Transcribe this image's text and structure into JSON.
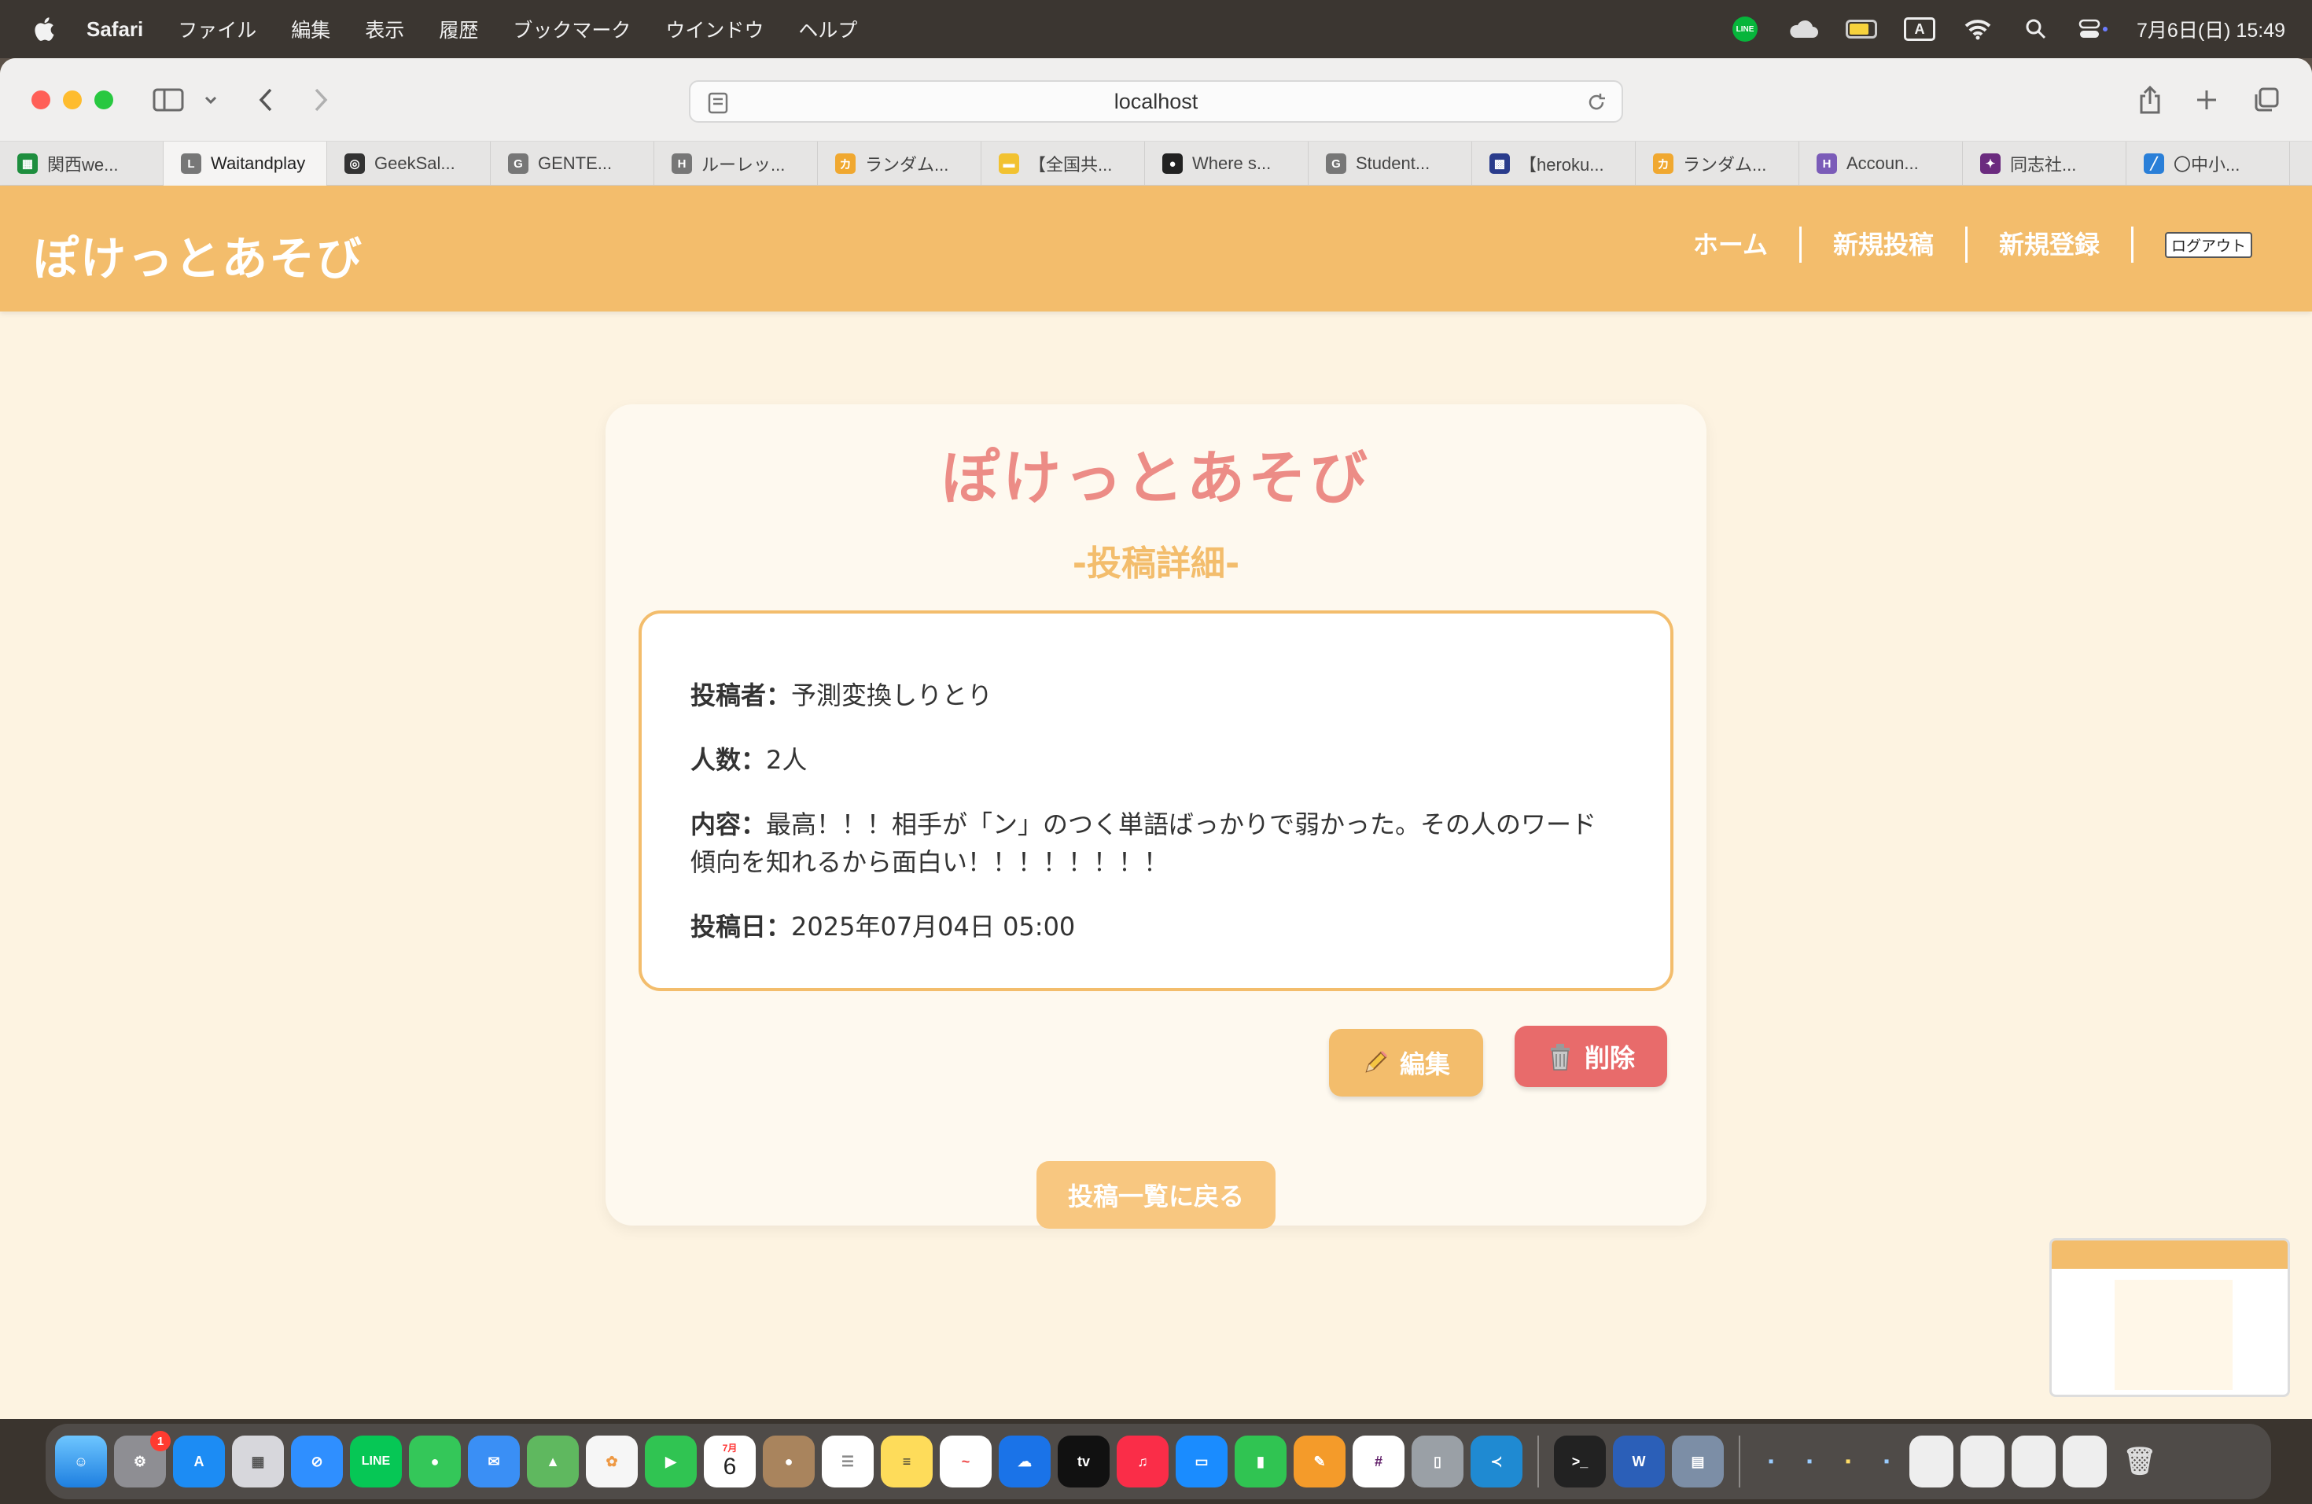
{
  "menubar": {
    "app_name": "Safari",
    "items": [
      "ファイル",
      "編集",
      "表示",
      "履歴",
      "ブックマーク",
      "ウインドウ",
      "ヘルプ"
    ],
    "line_label": "LINE",
    "clock": "7月6日(日) 15:49",
    "input_mode": "A"
  },
  "browser": {
    "url": "localhost",
    "tabs": [
      {
        "label": "関西we...",
        "icon": "sheets-icon",
        "color": "#1e8e3e",
        "glyph": "▦"
      },
      {
        "label": "Waitandplay",
        "icon": "letter-l-icon",
        "color": "#777777",
        "glyph": "L"
      },
      {
        "label": "GeekSal...",
        "icon": "geeksalon-icon",
        "color": "#333333",
        "glyph": "◎"
      },
      {
        "label": "GENTE...",
        "icon": "letter-g-icon",
        "color": "#777777",
        "glyph": "G"
      },
      {
        "label": "ルーレッ...",
        "icon": "letter-h-icon",
        "color": "#777777",
        "glyph": "H"
      },
      {
        "label": "ランダム...",
        "icon": "katakana-ka-icon",
        "color": "#f0a830",
        "glyph": "カ"
      },
      {
        "label": "【全国共...",
        "icon": "folder-icon",
        "color": "#f2c230",
        "glyph": "▬"
      },
      {
        "label": "Where s...",
        "icon": "github-icon",
        "color": "#222222",
        "glyph": "●"
      },
      {
        "label": "Student...",
        "icon": "letter-g-icon",
        "color": "#777777",
        "glyph": "G"
      },
      {
        "label": "【heroku...",
        "icon": "heroku-icon",
        "color": "#2a3c8c",
        "glyph": "▩"
      },
      {
        "label": "ランダム...",
        "icon": "katakana-ka-icon",
        "color": "#f0a830",
        "glyph": "カ"
      },
      {
        "label": "Accoun...",
        "icon": "heroku-h-icon",
        "color": "#7b5cb8",
        "glyph": "H"
      },
      {
        "label": "同志社...",
        "icon": "doshisha-icon",
        "color": "#6b2b7f",
        "glyph": "✦"
      },
      {
        "label": "〇中小...",
        "icon": "feather-icon",
        "color": "#2a7fd8",
        "glyph": "╱"
      }
    ]
  },
  "site": {
    "logo": "ぽけっとあそび",
    "nav": {
      "home": "ホーム",
      "new_post": "新規投稿",
      "signup": "新規登録",
      "logout": "ログアウト"
    }
  },
  "detail": {
    "title": "ぽけっとあそび",
    "subtitle": "-投稿詳細-",
    "poster_label": "投稿者：",
    "poster_value": "予測変換しりとり",
    "people_label": "人数：",
    "people_value": "2人",
    "content_label": "内容：",
    "content_value": "最高！！！相手が「ン」のつく単語ばっかりで弱かった。その人のワード傾向を知れるから面白い！！！！！！！！",
    "date_label": "投稿日：",
    "date_value": "2025年07月04日 05:00",
    "edit_label": "編集",
    "delete_label": "削除",
    "back_label": "投稿一覧に戻る"
  },
  "dock": {
    "settings_badge": "1",
    "calendar_month": "7月",
    "calendar_day": "6",
    "line_label": "LINE",
    "tv_label": "tv",
    "word_label": "W"
  },
  "colors": {
    "header": "#f3bd6c",
    "title": "#ec8c86",
    "delete": "#e86b6b",
    "background": "#fdf3e1"
  }
}
